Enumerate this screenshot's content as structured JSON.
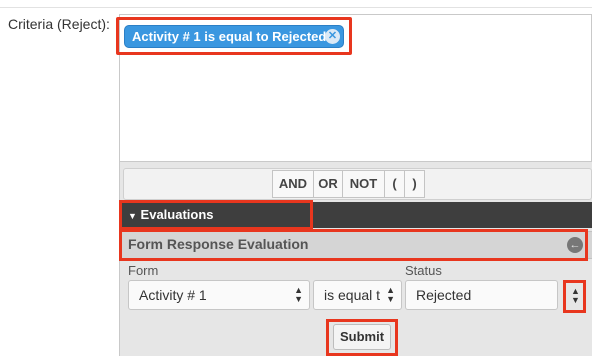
{
  "criteria": {
    "label": "Criteria (Reject):",
    "pill_text": "Activity # 1 is equal to Rejected",
    "pill_remove_icon": "x-circle-icon"
  },
  "operators": [
    "AND",
    "OR",
    "NOT",
    "(",
    ")"
  ],
  "evaluations": {
    "header": "Evaluations",
    "toggle_icon": "caret-down-icon"
  },
  "form_response": {
    "title": "Form Response Evaluation",
    "collapse_icon": "arrow-left-circle-icon",
    "form_label": "Form",
    "form_value": "Activity # 1",
    "operator_value": "is equal t",
    "status_label": "Status",
    "status_value": "Rejected"
  },
  "submit_label": "Submit",
  "colors": {
    "highlight": "#e8361e",
    "pill": "#3a97e0",
    "eval_bar": "#3e3e3e"
  }
}
